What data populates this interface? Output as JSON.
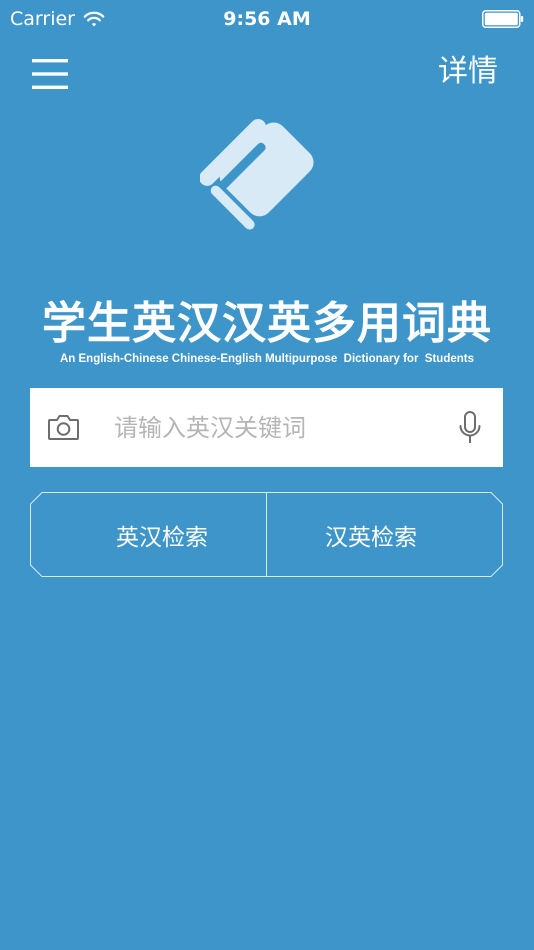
{
  "status_bar": {
    "carrier": "Carrier",
    "time": "9:56 AM",
    "wifi_icon": "wifi-icon",
    "battery_icon": "battery-icon"
  },
  "header": {
    "menu_icon": "hamburger-menu-icon",
    "details_label": "详情"
  },
  "app": {
    "logo_icon": "book-logo-icon",
    "title": "学生英汉汉英多用词典",
    "subtitle": "An English-Chinese Chinese-English Multipurpose  Dictionary for  Students"
  },
  "search": {
    "placeholder": "请输入英汉关键词",
    "value": "",
    "camera_icon": "camera-icon",
    "mic_icon": "microphone-icon"
  },
  "modes": {
    "en_to_zh_label": "英汉检索",
    "zh_to_en_label": "汉英检索"
  },
  "colors": {
    "background": "#3d95c9",
    "text": "#ffffff",
    "search_background": "#ffffff",
    "placeholder": "#b5b5b5",
    "icon_gray": "#6d6d6d",
    "logo_light": "#d8eaf6"
  }
}
